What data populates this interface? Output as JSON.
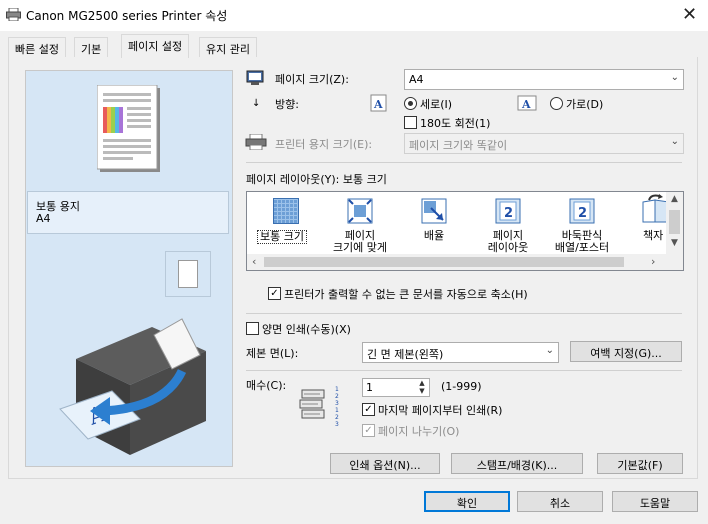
{
  "window": {
    "title": "Canon MG2500 series Printer 속성",
    "close": "✕"
  },
  "tabs": [
    "빠른 설정",
    "기본",
    "페이지 설정",
    "유지 관리"
  ],
  "preview": {
    "paper_type": "보통 용지",
    "paper_size": "A4"
  },
  "page_size": {
    "label": "페이지 크기(Z):",
    "value": "A4"
  },
  "orientation": {
    "label": "방향:",
    "portrait": "세로(I)",
    "landscape": "가로(D)",
    "selected": "portrait",
    "rotate180": "180도 회전(1)"
  },
  "printer_paper": {
    "label": "프린터 용지 크기(E):",
    "value": "페이지 크기와 똑같이"
  },
  "layout": {
    "label": "페이지 레이아웃(Y): 보통 크기",
    "options": [
      {
        "line1": "보통 크기",
        "line2": ""
      },
      {
        "line1": "페이지",
        "line2": "크기에 맞게"
      },
      {
        "line1": "배율",
        "line2": ""
      },
      {
        "line1": "페이지",
        "line2": "레이아웃"
      },
      {
        "line1": "바둑판식",
        "line2": "배열/포스터"
      },
      {
        "line1": "책자",
        "line2": ""
      }
    ],
    "icon_digit": "2"
  },
  "auto_reduce": "프린터가 출력할 수 없는 큰 문서를 자동으로 축소(H)",
  "duplex": {
    "label": "양면 인쇄(수동)(X)",
    "binding_label": "제본 면(L):",
    "binding_value": "긴 면 제본(왼쪽)",
    "margin_button": "여백 지정(G)..."
  },
  "copies": {
    "label": "매수(C):",
    "value": "1",
    "range": "(1-999)",
    "reverse": "마지막 페이지부터 인쇄(R)",
    "collate": "페이지 나누기(O)",
    "stack_digits": "1 2 3 1 2 3"
  },
  "buttons": {
    "print_options": "인쇄 옵션(N)...",
    "stamp": "스탬프/배경(K)...",
    "defaults": "기본값(F)",
    "ok": "확인",
    "cancel": "취소",
    "help": "도움말"
  },
  "colors": {
    "accent": "#0078d7",
    "preview_bg": "#d6e6f5"
  }
}
